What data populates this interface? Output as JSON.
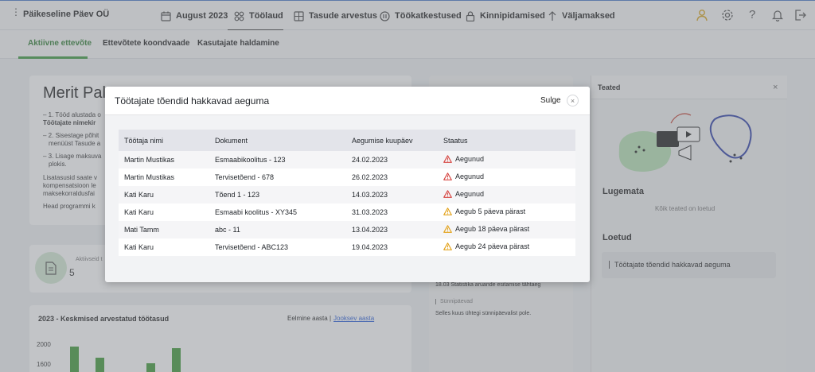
{
  "topbar": {
    "company": "Päikeseline Päev OÜ",
    "nav": [
      {
        "label": "August 2023",
        "icon": "calendar-icon"
      },
      {
        "label": "Töölaud",
        "icon": "dashboard-icon"
      },
      {
        "label": "Tasude arvestus",
        "icon": "calculator-icon"
      },
      {
        "label": "Töökatkestused",
        "icon": "pause-icon"
      },
      {
        "label": "Kinnipidamised",
        "icon": "lock-icon"
      },
      {
        "label": "Väljamaksed",
        "icon": "arrow-up-icon"
      }
    ],
    "active_nav": "Töölaud",
    "right_icons": [
      "user-icon",
      "gear-icon",
      "help-icon",
      "bell-icon",
      "logout-icon"
    ],
    "accent_user_icon": "#d8a31a"
  },
  "subnav": {
    "tabs": [
      "Aktiivne ettevõte",
      "Ettevõtete koondvaade",
      "Kasutajate haldamine"
    ],
    "active": "Aktiivne ettevõte",
    "active_color": "#3d9a3f"
  },
  "welcome": {
    "title": "Merit Pal",
    "lines": [
      "– 1. Tööd alustada o",
      "Töötajate nimekir",
      "– 2. Sisestage põhit",
      "menüüst Tasude a",
      "– 3. Lisage maksuva",
      "plokis.",
      "Lisatasusid saate v",
      "kompensatsioon le",
      "maksekorraldusfai",
      "Head programmi k"
    ]
  },
  "stat": {
    "label": "Aktiivseid t",
    "value": "5",
    "icon": "document-icon"
  },
  "chart": {
    "title": "2023 - Keskmised arvestatud töötasud",
    "prev_label": "Eelmine aasta",
    "separator": "|",
    "next_label": "Jooksev aasta",
    "ticks": [
      "2000",
      "1600"
    ]
  },
  "chart_data": {
    "type": "bar",
    "title": "2023 - Keskmised arvestatud töötasud",
    "categories": [
      "",
      "",
      "",
      "",
      ""
    ],
    "values": [
      1940,
      1720,
      1350,
      1620,
      1920
    ],
    "ylim": [
      1350,
      2100
    ]
  },
  "mid": {
    "deadline": "18.03 Statistika aruande esitamise tähtaeg",
    "bday_heading": "Sünnipäevad",
    "bday_text": "Selles kuus ühtegi sünnipäevalist pole."
  },
  "notifications": {
    "title": "Teated",
    "close": "×",
    "unread_heading": "Lugemata",
    "unread_empty": "Kõik teated on loetud",
    "read_heading": "Loetud",
    "read_items": [
      "Töötajate tõendid hakkavad aeguma"
    ]
  },
  "modal": {
    "title": "Töötajate tõendid hakkavad aeguma",
    "close_label": "Sulge",
    "close_icon": "×",
    "columns": [
      "Töötaja nimi",
      "Dokument",
      "Aegumise kuupäev",
      "Staatus"
    ],
    "rows": [
      {
        "name": "Martin Mustikas",
        "doc": "Esmaabikoolitus - 123",
        "date": "24.02.2023",
        "status": "Aegunud",
        "level": "expired"
      },
      {
        "name": "Martin Mustikas",
        "doc": "Tervisetõend - 678",
        "date": "26.02.2023",
        "status": "Aegunud",
        "level": "expired"
      },
      {
        "name": "Kati Karu",
        "doc": "Tõend 1 - 123",
        "date": "14.03.2023",
        "status": "Aegunud",
        "level": "expired"
      },
      {
        "name": "Kati Karu",
        "doc": "Esmaabi koolitus - XY345",
        "date": "31.03.2023",
        "status": "Aegub 5 päeva pärast",
        "level": "warning"
      },
      {
        "name": "Mati Tamm",
        "doc": "abc - 11",
        "date": "13.04.2023",
        "status": "Aegub 18 päeva pärast",
        "level": "warning"
      },
      {
        "name": "Kati Karu",
        "doc": "Tervisetõend - ABC123",
        "date": "19.04.2023",
        "status": "Aegub 24 päeva pärast",
        "level": "warning"
      }
    ],
    "colors": {
      "expired": "#d64541",
      "warning": "#e3a21a"
    }
  }
}
